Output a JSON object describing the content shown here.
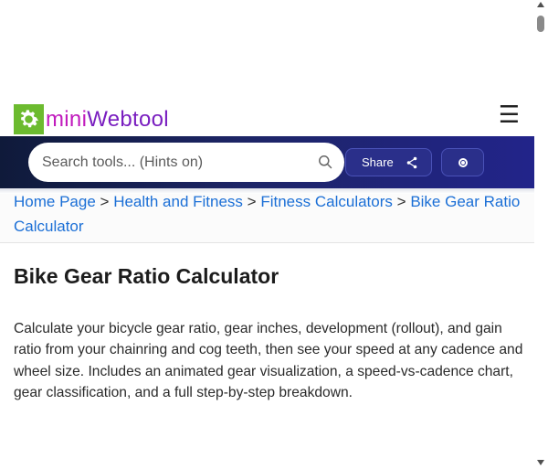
{
  "header": {
    "logo_mini": "mini",
    "logo_web": "Webtool",
    "menu_icon": "hamburger-icon",
    "menu_glyph": "☰"
  },
  "search": {
    "placeholder": "Search tools... (Hints on)",
    "icon": "search-icon"
  },
  "share": {
    "label": "Share",
    "icon": "share-icon"
  },
  "theme_toggle": {
    "icon": "theme-toggle-icon"
  },
  "breadcrumb": {
    "items": [
      "Home Page",
      "Health and Fitness",
      "Fitness Calculators",
      "Bike Gear Ratio Calculator"
    ],
    "separator": ">"
  },
  "main": {
    "title": "Bike Gear Ratio Calculator",
    "description": "Calculate your bicycle gear ratio, gear inches, development (rollout), and gain ratio from your chainring and cog teeth, then see your speed at any cadence and wheel size. Includes an animated gear visualization, a speed-vs-cadence chart, gear classification, and a full step-by-step breakdown."
  },
  "colors": {
    "logo_green": "#6cbb2f",
    "logo_mini": "#c11bbd",
    "logo_web": "#7a1fc0",
    "link": "#1b6fd6",
    "band_dark": "#0f1a3a",
    "band_blue": "#22248a"
  }
}
